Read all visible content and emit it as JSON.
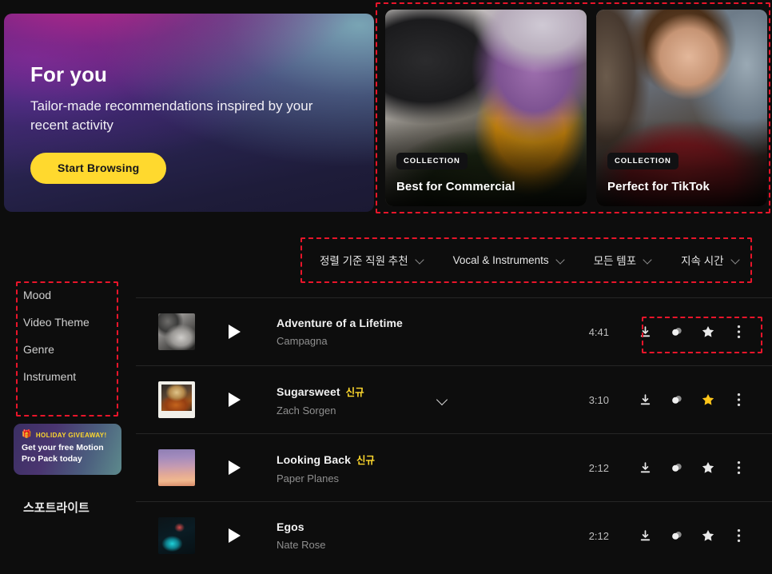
{
  "hero": {
    "title": "For you",
    "subtitle": "Tailor-made recommendations inspired by your recent activity",
    "button_label": "Start Browsing",
    "accent_color": "#FFD92E"
  },
  "collections": [
    {
      "badge": "COLLECTION",
      "title": "Best for Commercial",
      "image": "videographer-filming-model-photo"
    },
    {
      "badge": "COLLECTION",
      "title": "Perfect for TikTok",
      "image": "curly-haired-person-red-shirt-photo"
    }
  ],
  "filters": [
    {
      "label": "정렬 기준 직원 추천",
      "icon": "chevron-down-icon"
    },
    {
      "label": "Vocal & Instruments",
      "icon": "chevron-down-icon"
    },
    {
      "label": "모든 템포",
      "icon": "chevron-down-icon"
    },
    {
      "label": "지속 시간",
      "icon": "chevron-down-icon"
    }
  ],
  "sidebar": {
    "facets": [
      {
        "label": "Mood"
      },
      {
        "label": "Video Theme"
      },
      {
        "label": "Genre"
      },
      {
        "label": "Instrument"
      }
    ],
    "promo": {
      "icon": "gift-icon",
      "eyebrow": "HOLIDAY GIVEAWAY!",
      "body": "Get your free Motion Pro Pack today",
      "eyebrow_color": "#FFD92E"
    },
    "spotlight_heading": "스포트라이트"
  },
  "tracks": [
    {
      "title": "Adventure of a Lifetime",
      "badge": "",
      "artist": "Campagna",
      "duration": "4:41",
      "thumb": "black-and-white-photo-thumbnail",
      "starred": false,
      "has_expander": false
    },
    {
      "title": "Sugarsweet",
      "badge": "신규",
      "artist": "Zach Sorgen",
      "duration": "3:10",
      "thumb": "polaroid-guitar-photo-thumbnail",
      "starred": true,
      "has_expander": true
    },
    {
      "title": "Looking Back",
      "badge": "신규",
      "artist": "Paper Planes",
      "duration": "2:12",
      "thumb": "sunset-gradient-thumbnail",
      "starred": false,
      "has_expander": false
    },
    {
      "title": "Egos",
      "badge": "",
      "artist": "Nate Rose",
      "duration": "2:12",
      "thumb": "dark-teal-night-thumbnail",
      "starred": false,
      "has_expander": false
    }
  ],
  "track_actions": {
    "download": "download-icon",
    "stems": "stems-icon",
    "favorite": "star-icon",
    "more": "kebab-menu-icon",
    "star_active_color": "#FFC61A"
  },
  "annotations": {
    "collections_box": "red-dashed-highlight",
    "filters_box": "red-dashed-highlight",
    "facets_box": "red-dashed-highlight",
    "row_actions_box": "red-dashed-highlight"
  }
}
